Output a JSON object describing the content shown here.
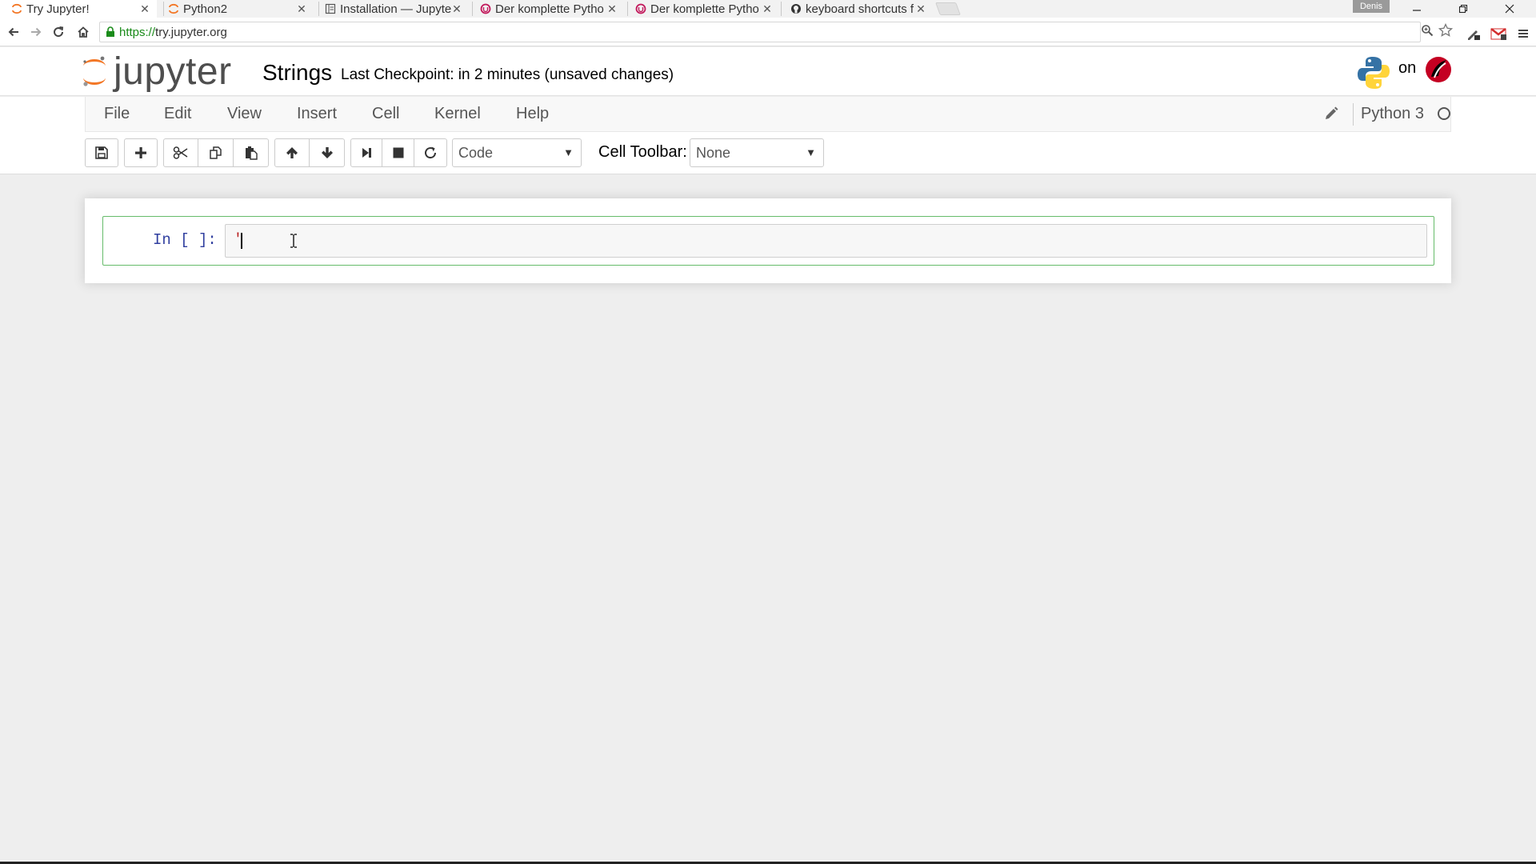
{
  "browser": {
    "tabs": [
      {
        "title": "Try Jupyter!",
        "favicon": "jupyter-icon",
        "active": true
      },
      {
        "title": "Python2",
        "favicon": "jupyter-icon",
        "active": false
      },
      {
        "title": "Installation — Jupyte",
        "favicon": "document-icon",
        "active": false
      },
      {
        "title": "Der komplette Pytho",
        "favicon": "udemy-icon",
        "active": false
      },
      {
        "title": "Der komplette Pytho",
        "favicon": "udemy-icon",
        "active": false
      },
      {
        "title": "keyboard shortcuts f",
        "favicon": "github-icon",
        "active": false
      }
    ],
    "profile_name": "Denis",
    "url_scheme": "https://",
    "url_host": "try.jupyter.org",
    "colors": {
      "secure": "#1a8b1a",
      "mail_badge": "#d32f2f"
    }
  },
  "jupyter": {
    "logo_text": "jupyter",
    "notebook_name": "Strings",
    "checkpoint": "Last Checkpoint: in 2 minutes (unsaved changes)",
    "hosted_on": "on",
    "menu": [
      "File",
      "Edit",
      "View",
      "Insert",
      "Cell",
      "Kernel",
      "Help"
    ],
    "kernel": "Python 3",
    "cell_type": "Code",
    "cell_toolbar_label": "Cell Toolbar:",
    "cell_toolbar_value": "None",
    "colors": {
      "logo_orange": "#f37726",
      "prompt": "#303f9f",
      "cell_border": "#66bb6a",
      "string": "#ba2121"
    }
  },
  "cell": {
    "prompt": "In [ ]:",
    "code": "'"
  }
}
